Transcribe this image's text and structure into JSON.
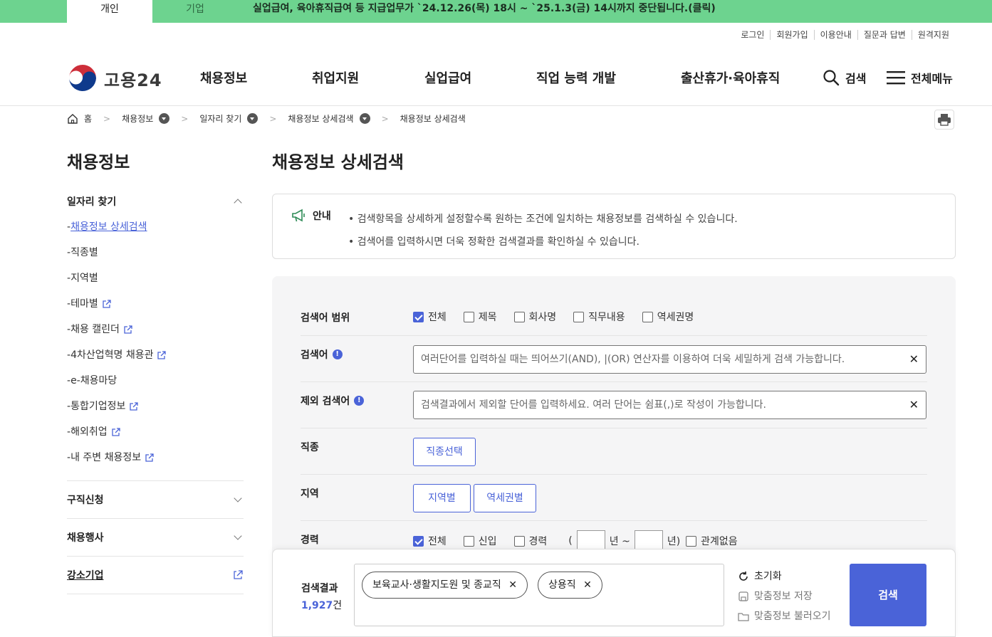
{
  "topbar": {
    "tab_personal": "개인",
    "tab_company": "기업",
    "notice": "실업급여, 육아휴직급여 등 지급업무가 `24.12.26(목) 18시 ~ `25.1.3(금) 14시까지 중단됩니다.(클릭)"
  },
  "util": [
    "로그인",
    "회원가입",
    "이용안내",
    "질문과 답변",
    "원격지원"
  ],
  "logo": {
    "text": "고용24"
  },
  "gnb": [
    "채용정보",
    "취업지원",
    "실업급여",
    "직업 능력 개발",
    "출산휴가·육아휴직"
  ],
  "header": {
    "search_label": "검색",
    "allmenu_label": "전체메뉴"
  },
  "breadcrumb": {
    "home": "홈",
    "items": [
      "채용정보",
      "일자리 찾기",
      "채용정보 상세검색",
      "채용정보 상세검색"
    ]
  },
  "sidebar": {
    "title": "채용정보",
    "group1": "일자리 찾기",
    "subitems": [
      "채용정보 상세검색",
      "직종별",
      "지역별",
      "테마별",
      "채용 캘린더",
      "4차산업혁명 채용관",
      "e-채용마당",
      "통합기업정보",
      "해외취업",
      "내 주변 채용정보"
    ],
    "group2": "구직신청",
    "group3": "채용행사",
    "group4": "강소기업"
  },
  "main": {
    "title": "채용정보 상세검색",
    "guide_label": "안내",
    "guide_lines": [
      "• 검색항목을 상세하게 설정할수록 원하는 조건에 일치하는 채용정보를 검색하실 수 있습니다.",
      "• 검색어를 입력하시면 더욱 정확한 검색결과를 확인하실 수 있습니다."
    ]
  },
  "form": {
    "scope_label": "검색어 범위",
    "scope_options": [
      "전체",
      "제목",
      "회사명",
      "직무내용",
      "역세권명"
    ],
    "keyword_label": "검색어",
    "keyword_placeholder": "여러단어를 입력하실 때는 띄어쓰기(AND), |(OR) 연산자를 이용하여 더욱 세밀하게 검색 가능합니다.",
    "exclude_label": "제외 검색어",
    "exclude_placeholder": "검색결과에서 제외할 단어를 입력하세요. 여러 단어는 쉼표(,)로 작성이 가능합니다.",
    "job_label": "직종",
    "job_button": "직종선택",
    "region_label": "지역",
    "region_buttons": [
      "지역별",
      "역세권별"
    ],
    "career_label": "경력",
    "career_options": [
      "전체",
      "신입",
      "경력"
    ],
    "year_open": "(",
    "year_mid": "년 ~",
    "year_close": "년)",
    "career_none": "관계없음"
  },
  "result": {
    "label": "검색결과",
    "count": "1,927",
    "unit": "건",
    "tags": [
      "보육교사·생활지도원 및 종교직",
      "상용직"
    ],
    "reset": "초기화",
    "save": "맞춤정보 저장",
    "load": "맞춤정보 불러오기",
    "search_button": "검색"
  },
  "colors": {
    "accent": "#4a63d8",
    "topbar": "#6dd38f"
  }
}
